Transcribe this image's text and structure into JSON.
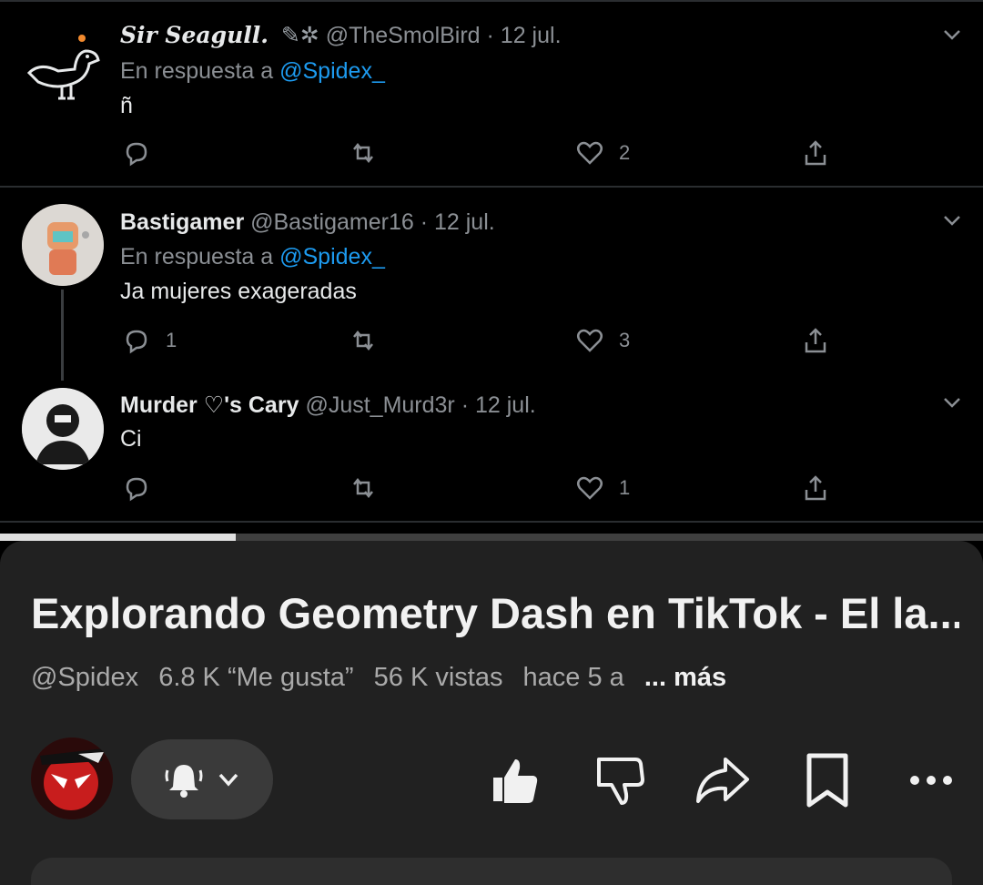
{
  "tweets": [
    {
      "name": "Sir Seagull.",
      "handle": "@TheSmolBird",
      "date": "· 12 jul.",
      "reply_prefix": "En respuesta a",
      "reply_to": "@Spidex_",
      "text": "ñ",
      "reply_count": "",
      "retweet_count": "",
      "like_count": "2"
    },
    {
      "name": "Bastigamer",
      "handle": "@Bastigamer16",
      "date": "· 12 jul.",
      "reply_prefix": "En respuesta a",
      "reply_to": "@Spidex_",
      "text": "Ja mujeres exageradas",
      "reply_count": "1",
      "retweet_count": "",
      "like_count": "3"
    },
    {
      "name": "Murder ♡'s Cary",
      "handle": "@Just_Murd3r",
      "date": "· 12 jul.",
      "text": "Ci",
      "reply_count": "",
      "retweet_count": "",
      "like_count": "1"
    }
  ],
  "video": {
    "progress": 0.24,
    "title": "Explorando Geometry Dash en TikTok - El la...",
    "channel": "@Spidex",
    "likes": "6.8 K “Me gusta”",
    "views": "56 K vistas",
    "age": "hace 5 a",
    "more": "... más"
  },
  "icons": {
    "reply": "reply-icon",
    "retweet": "retweet-icon",
    "like": "heart-icon",
    "share": "share-icon",
    "menu": "chevron-down-icon",
    "bell": "bell-icon",
    "thumbs_up": "thumbs-up-icon",
    "thumbs_down": "thumbs-down-icon",
    "yt_share": "share-arrow-icon",
    "save": "bookmark-icon",
    "more": "more-horizontal-icon"
  },
  "colors": {
    "twitter_bg": "#000000",
    "mention": "#1d9bf0",
    "panel_bg": "#212121",
    "progress_fill": "#e0e0e0"
  }
}
